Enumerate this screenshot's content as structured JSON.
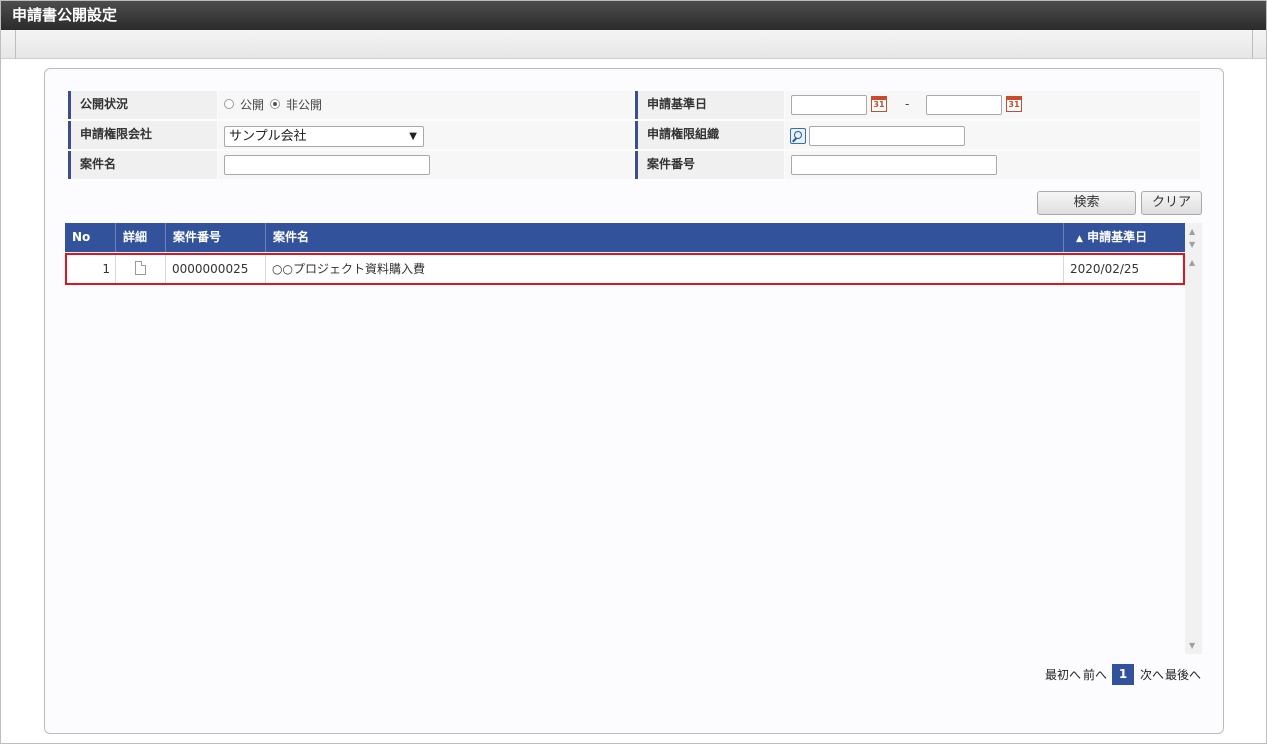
{
  "window": {
    "title": "申請書公開設定"
  },
  "form": {
    "publish_status": {
      "label": "公開状況",
      "options": [
        "公開",
        "非公開"
      ],
      "selected": "非公開"
    },
    "apply_base_date": {
      "label": "申請基準日",
      "from": "",
      "to": "",
      "separator": "-",
      "calendar_icon_text": "31"
    },
    "authority_company": {
      "label": "申請権限会社",
      "value": "サンプル会社"
    },
    "authority_org": {
      "label": "申請権限組織",
      "value": ""
    },
    "matter_name": {
      "label": "案件名",
      "value": ""
    },
    "matter_number": {
      "label": "案件番号",
      "value": ""
    }
  },
  "buttons": {
    "search": "検索",
    "clear": "クリア"
  },
  "grid": {
    "columns": [
      "No",
      "詳細",
      "案件番号",
      "案件名",
      "申請基準日"
    ],
    "sort_indicator": "▲",
    "rows": [
      {
        "no": "1",
        "matter_number": "0000000025",
        "matter_name": "○○プロジェクト資料購入費",
        "apply_base_date": "2020/02/25"
      }
    ]
  },
  "pager": {
    "first": "最初へ",
    "prev": "前へ",
    "current": "1",
    "next": "次へ",
    "last": "最後へ"
  },
  "colors": {
    "header_blue": "#33529c",
    "highlight_red": "#e0141e",
    "title_bar": "#3a3a3a"
  }
}
